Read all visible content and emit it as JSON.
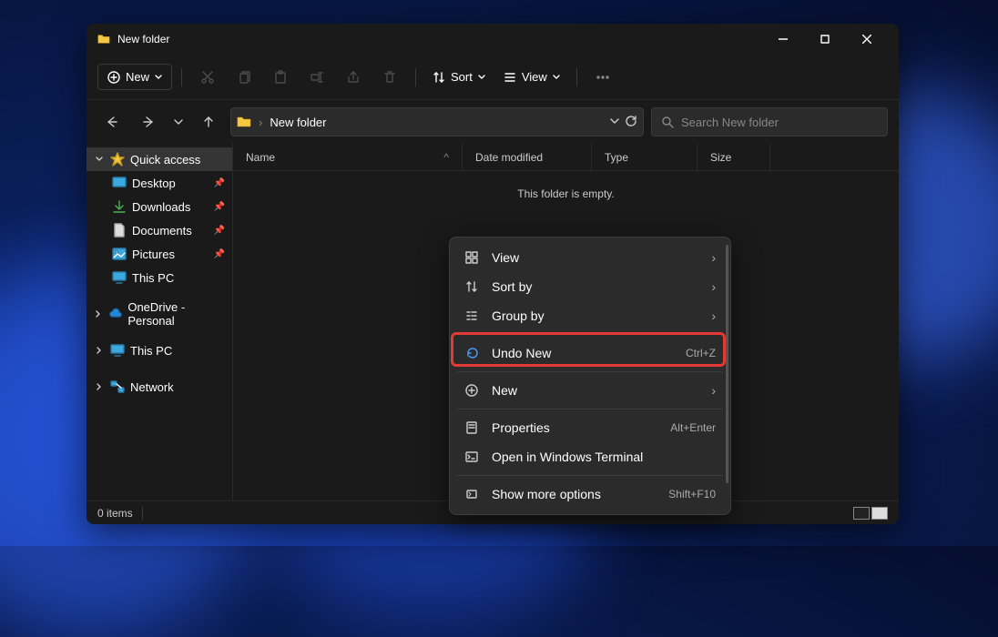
{
  "window": {
    "title": "New folder"
  },
  "toolbar": {
    "new_label": "New",
    "sort_label": "Sort",
    "view_label": "View"
  },
  "address": {
    "path": "New folder",
    "search_placeholder": "Search New folder"
  },
  "sidebar": {
    "quick_access": "Quick access",
    "items": [
      {
        "label": "Desktop"
      },
      {
        "label": "Downloads"
      },
      {
        "label": "Documents"
      },
      {
        "label": "Pictures"
      },
      {
        "label": "This PC"
      }
    ],
    "onedrive": "OneDrive - Personal",
    "this_pc": "This PC",
    "network": "Network"
  },
  "columns": {
    "name": "Name",
    "date": "Date modified",
    "type": "Type",
    "size": "Size"
  },
  "content": {
    "empty": "This folder is empty."
  },
  "context_menu": {
    "view": "View",
    "sort_by": "Sort by",
    "group_by": "Group by",
    "undo_new": "Undo New",
    "undo_shortcut": "Ctrl+Z",
    "new": "New",
    "properties": "Properties",
    "properties_shortcut": "Alt+Enter",
    "terminal": "Open in Windows Terminal",
    "more": "Show more options",
    "more_shortcut": "Shift+F10"
  },
  "status": {
    "items": "0 items"
  }
}
